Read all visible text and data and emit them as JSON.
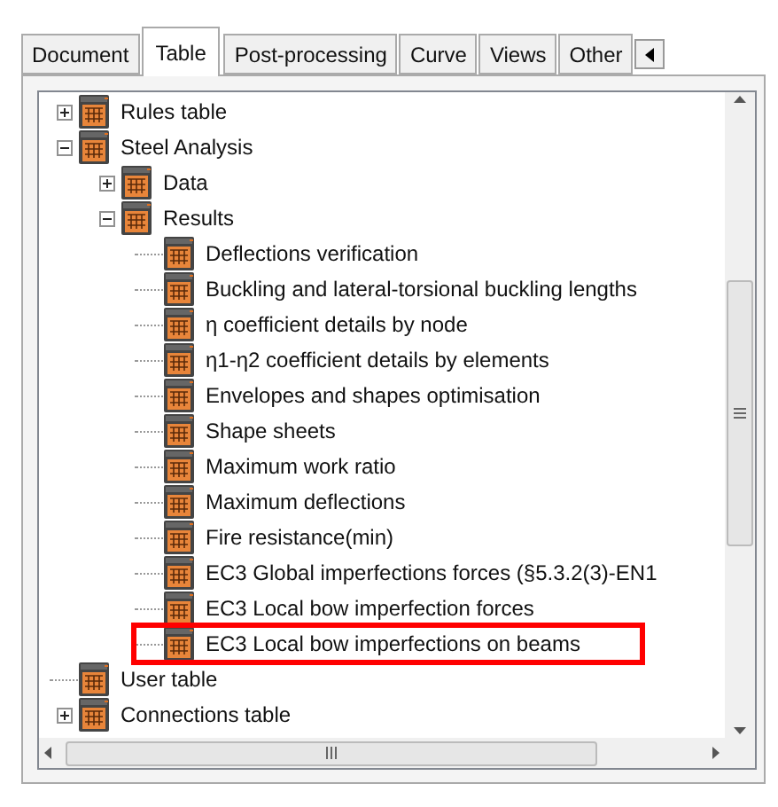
{
  "tabs": [
    {
      "label": "Document",
      "selected": false
    },
    {
      "label": "Table",
      "selected": true
    },
    {
      "label": "Post-processing",
      "selected": false
    },
    {
      "label": "Curve",
      "selected": false
    },
    {
      "label": "Views",
      "selected": false
    },
    {
      "label": "Other",
      "selected": false
    }
  ],
  "tree": [
    {
      "label": "Rules table",
      "expanded": false
    },
    {
      "label": "Steel Analysis",
      "expanded": true,
      "children": [
        {
          "label": "Data",
          "expanded": false
        },
        {
          "label": "Results",
          "expanded": true,
          "children": [
            {
              "label": "Deflections verification"
            },
            {
              "label": "Buckling and lateral-torsional buckling lengths"
            },
            {
              "label": "η coefficient details by node"
            },
            {
              "label": "η1-η2 coefficient details by elements"
            },
            {
              "label": "Envelopes and shapes optimisation"
            },
            {
              "label": "Shape sheets"
            },
            {
              "label": "Maximum work ratio"
            },
            {
              "label": "Maximum deflections"
            },
            {
              "label": "Fire resistance(min)"
            },
            {
              "label": "EC3 Global imperfections forces (§5.3.2(3)-EN1"
            },
            {
              "label": "EC3 Local bow imperfection forces"
            },
            {
              "label": "EC3 Local bow imperfections on beams",
              "highlighted": true
            }
          ]
        }
      ]
    },
    {
      "label": "User table"
    },
    {
      "label": "Connections table",
      "expanded": false
    }
  ]
}
